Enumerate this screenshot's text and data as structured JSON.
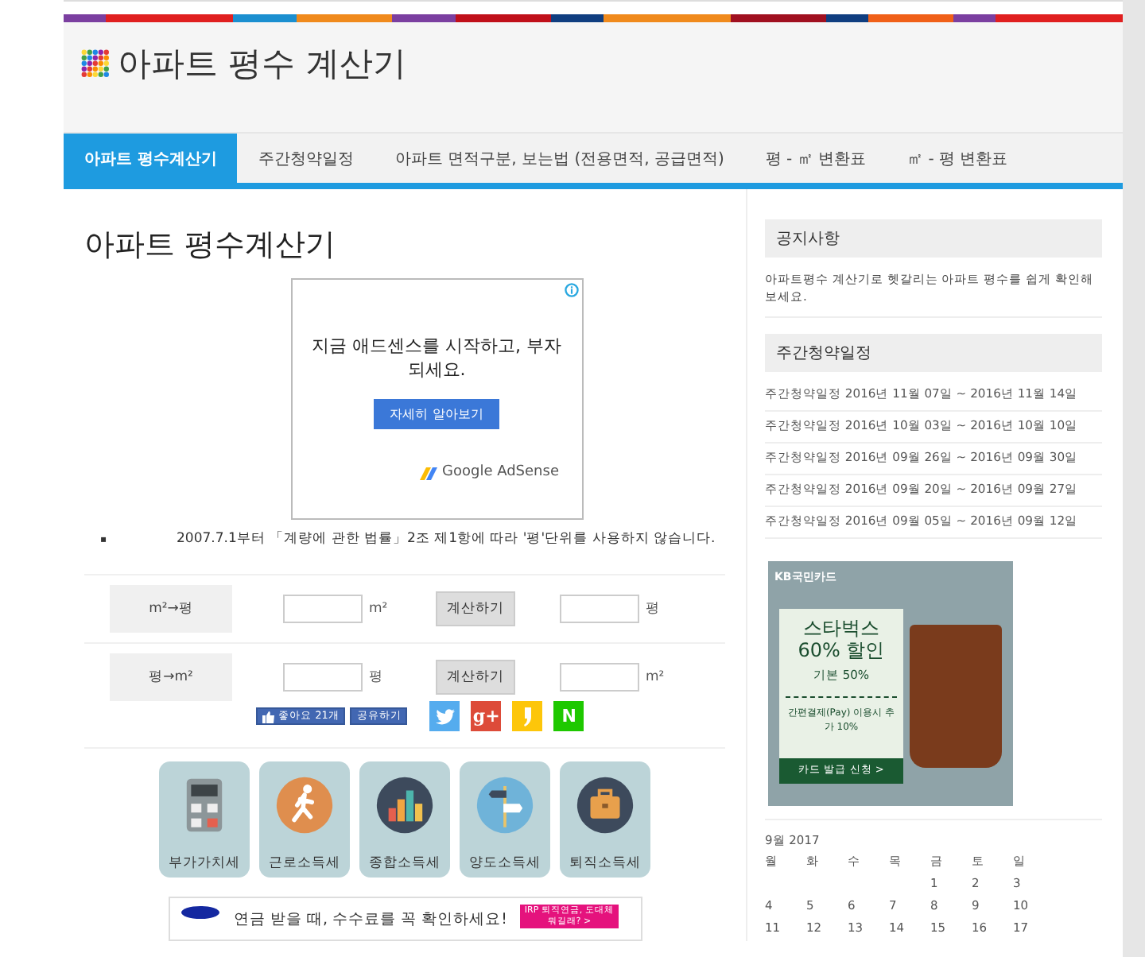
{
  "header": {
    "title": "아파트 평수 계산기"
  },
  "nav": [
    {
      "label": "아파트 평수계산기",
      "selected": true
    },
    {
      "label": "주간청약일정",
      "selected": false
    },
    {
      "label": "아파트 면적구분, 보는법 (전용면적, 공급면적)",
      "selected": false
    },
    {
      "label": "평 - ㎡ 변환표",
      "selected": false
    },
    {
      "label": "㎡ - 평 변환표",
      "selected": false
    }
  ],
  "main": {
    "title": "아파트 평수계산기",
    "ad": {
      "headline": "지금 애드센스를 시작하고, 부자되세요.",
      "button": "자세히 알아보기",
      "brand": "Google AdSense"
    },
    "notes": [
      {
        "marker": "▪",
        "text": "2007.7.1부터 「계량에 관한 법률」2조 제1항에 따라 '평'단위를 사용하지 않습니다."
      }
    ],
    "converters": [
      {
        "label": "m²→평",
        "input_unit": "m²",
        "button": "계산하기",
        "output_unit": "평"
      },
      {
        "label": "평→m²",
        "input_unit": "평",
        "button": "계산하기",
        "output_unit": "m²"
      }
    ],
    "social": {
      "like": "좋아요 21개",
      "share": "공유하기",
      "buttons": [
        {
          "kind": "twitter"
        },
        {
          "kind": "google",
          "text": "g+"
        },
        {
          "kind": "kakao"
        },
        {
          "kind": "naver",
          "text": "N"
        }
      ]
    },
    "tax_links": [
      {
        "label": "부가가치세",
        "kind": "calculator"
      },
      {
        "label": "근로소득세",
        "kind": "runner"
      },
      {
        "label": "종합소득세",
        "kind": "bars"
      },
      {
        "label": "양도소득세",
        "kind": "signpost"
      },
      {
        "label": "퇴직소득세",
        "kind": "briefcase"
      }
    ],
    "bottom_ad": {
      "headline": "연금 받을 때, 수수료를 꼭 확인하세요!",
      "cta": "IRP 퇴직연금, 도대체 뭐길래? >"
    }
  },
  "sidebar": {
    "notice": {
      "title": "공지사항",
      "text": "아파트평수 계산기로 헷갈리는 아파트 평수를 쉽게 확인해보세요."
    },
    "schedule": {
      "title": "주간청약일정",
      "items": [
        "주간청약일정 2016년 11월 07일 ~ 2016년 11월 14일",
        "주간청약일정 2016년 10월 03일 ~ 2016년 10월 10일",
        "주간청약일정 2016년 09월 26일 ~ 2016년 09월 30일",
        "주간청약일정 2016년 09월 20일 ~ 2016년 09월 27일",
        "주간청약일정 2016년 09월 05일 ~ 2016년 09월 12일"
      ]
    },
    "promo": {
      "brand": "KB국민카드",
      "headline": "스타벅스 60% 할인",
      "base": "기본 50%",
      "extra": "간편결제(Pay) 이용시 추가 10%",
      "cta": "카드 발급 신청 >"
    },
    "calendar": {
      "caption": "9월 2017",
      "weekdays": [
        "월",
        "화",
        "수",
        "목",
        "금",
        "토",
        "일"
      ],
      "weeks": [
        [
          "1",
          "2",
          "3"
        ],
        [
          "4",
          "5",
          "6",
          "7",
          "8",
          "9",
          "10"
        ],
        [
          "11",
          "12",
          "13",
          "14",
          "15",
          "16",
          "17"
        ]
      ]
    }
  }
}
